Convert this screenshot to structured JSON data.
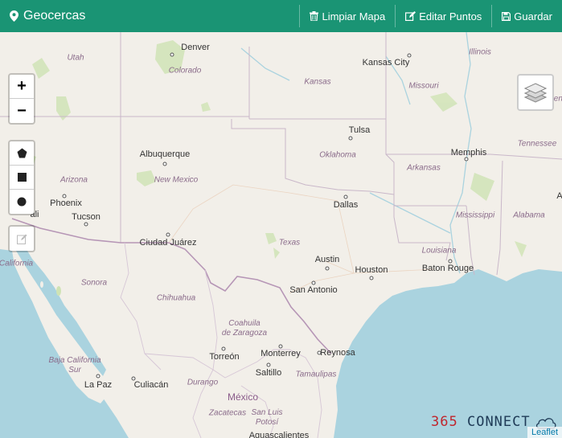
{
  "header": {
    "title": "Geocercas",
    "buttons": {
      "clear": "Limpiar Mapa",
      "edit": "Editar Puntos",
      "save": "Guardar"
    }
  },
  "controls": {
    "zoom_in": "+",
    "zoom_out": "−"
  },
  "map": {
    "cities": {
      "denver": "Denver",
      "kansas_city": "Kansas City",
      "tulsa": "Tulsa",
      "memphis": "Memphis",
      "albuquerque": "Albuquerque",
      "phoenix": "Phoenix",
      "tucson": "Tucson",
      "dallas": "Dallas",
      "ciudad_juarez": "Ciudad Juárez",
      "austin": "Austin",
      "houston": "Houston",
      "san_antonio": "San Antonio",
      "baton_rouge": "Baton Rouge",
      "torreon": "Torreón",
      "monterrey": "Monterrey",
      "reynosa": "Reynosa",
      "saltillo": "Saltillo",
      "la_paz": "La Paz",
      "culiacan": "Culiacán",
      "aguascalientes": "Aguascalientes",
      "mexicali_partial": "ali"
    },
    "states": {
      "utah": "Utah",
      "colorado": "Colorado",
      "kansas": "Kansas",
      "missouri": "Missouri",
      "illinois": "Illinois",
      "kentucky_partial": "Ken",
      "oklahoma": "Oklahoma",
      "tennessee": "Tennessee",
      "arkansas": "Arkansas",
      "arizona": "Arizona",
      "new_mexico": "New Mexico",
      "mississippi": "Mississippi",
      "alabama": "Alabama",
      "texas": "Texas",
      "louisiana": "Louisiana",
      "california": "California",
      "sonora": "Sonora",
      "chihuahua": "Chihuahua",
      "coahuila": "Coahuila\nde Zaragoza",
      "baja_california_sur": "Baja California\nSur",
      "durango": "Durango",
      "tamaulipas": "Tamaulipas",
      "zacatecas": "Zacatecas",
      "san_luis_potosi": "San Luis\nPotosí",
      "a_partial": "A"
    },
    "countries": {
      "mexico": "México"
    }
  },
  "brand": {
    "number": "365",
    "word": "CONNECT"
  },
  "attribution": "Leaflet",
  "colors": {
    "header_bg": "#1a9474",
    "land": "#f2efe9",
    "water": "#aad3df",
    "state_border": "#c9b7c9",
    "country_border": "#b696b6",
    "brand_red": "#c0262d",
    "brand_navy": "#1f3b57"
  }
}
